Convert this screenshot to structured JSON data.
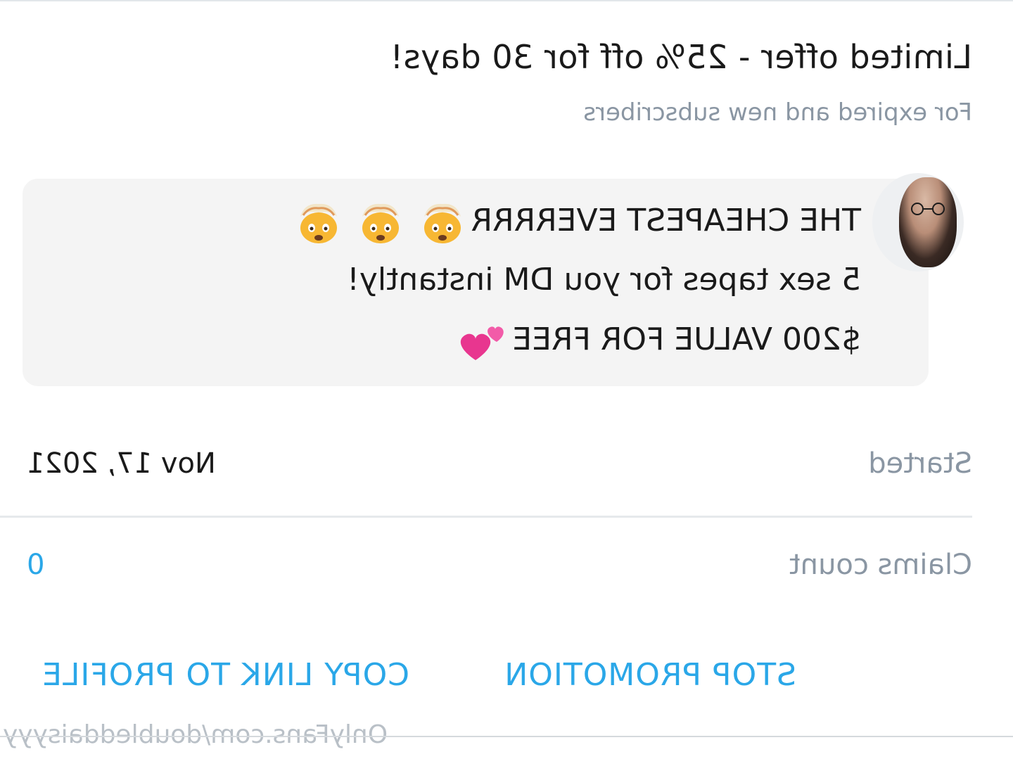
{
  "promotion": {
    "title": "Limited offer - 25% off for 30 days!",
    "subtitle": "For expired and new subscribers"
  },
  "message": {
    "line1": "THE CHEAPEST EVERRRR",
    "line1_icons": [
      "exploding-head-emoji",
      "exploding-head-emoji",
      "exploding-head-emoji"
    ],
    "line2": "5 sex tapes for you DM instantly!",
    "line3": "$200 VALUE FOR FREE",
    "line3_icon": "two-hearts-emoji"
  },
  "details": {
    "started_label": "Started",
    "started_value": "Nov 17, 2021",
    "claims_label": "Claims count",
    "claims_value": "0"
  },
  "actions": {
    "stop_label": "STOP PROMOTION",
    "copy_label": "COPY LINK TO PROFILE"
  },
  "watermark": "OnlyFans.com/doubleddaisyyy",
  "colors": {
    "accent": "#2aa7e8",
    "text": "#1a1a1a",
    "muted": "#8a96a3",
    "bubble": "#f4f4f4"
  },
  "view": {
    "mirrored": true
  }
}
